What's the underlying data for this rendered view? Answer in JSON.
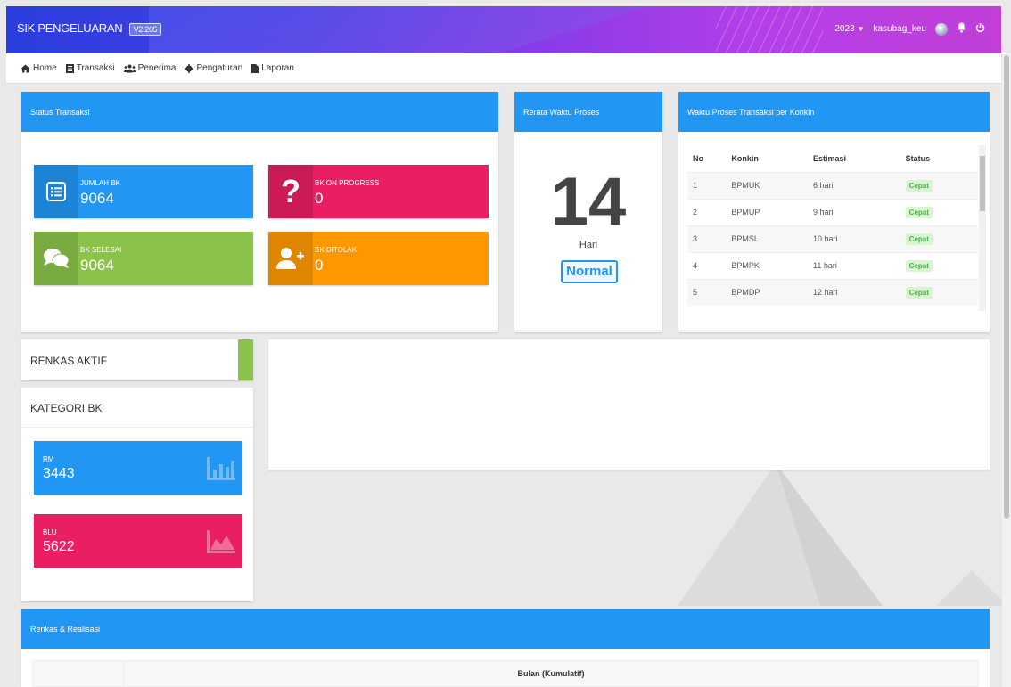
{
  "app": {
    "title": "SIK PENGELUARAN",
    "version": "V2.205"
  },
  "header": {
    "year": "2023",
    "user": "kasubag_keu"
  },
  "nav": [
    {
      "label": "Home",
      "icon": "home-icon"
    },
    {
      "label": "Transaksi",
      "icon": "list-icon"
    },
    {
      "label": "Penerima",
      "icon": "users-icon"
    },
    {
      "label": "Pengaturan",
      "icon": "gear-icon"
    },
    {
      "label": "Laporan",
      "icon": "report-icon"
    }
  ],
  "status_transaksi": {
    "title": "Status Transaksi",
    "tiles": [
      {
        "label": "JUMLAH BK",
        "value": "9064",
        "color": "#2196f3",
        "icon": "list-icon"
      },
      {
        "label": "BK ON PROGRESS",
        "value": "0",
        "color": "#e91e63",
        "icon": "question-icon"
      },
      {
        "label": "BK SELESAI",
        "value": "9064",
        "color": "#8bc34a",
        "icon": "chat-icon"
      },
      {
        "label": "BK DITOLAK",
        "value": "0",
        "color": "#ff9800",
        "icon": "user-plus-icon"
      }
    ]
  },
  "rerata": {
    "title": "Rerata Waktu Proses",
    "value": "14",
    "unit": "Hari",
    "status": "Normal"
  },
  "konkin": {
    "title": "Waktu Proses Transaksi per Konkin",
    "columns": [
      "No",
      "Konkin",
      "Estimasi",
      "Status"
    ],
    "rows": [
      [
        "1",
        "BPMUK",
        "6 hari",
        "Cepat"
      ],
      [
        "2",
        "BPMUP",
        "9 hari",
        "Cepat"
      ],
      [
        "3",
        "BPMSL",
        "10 hari",
        "Cepat"
      ],
      [
        "4",
        "BPMPK",
        "11 hari",
        "Cepat"
      ],
      [
        "5",
        "BPMDP",
        "12 hari",
        "Cepat"
      ]
    ]
  },
  "renkas_aktif": {
    "title": "RENKAS AKTIF"
  },
  "kategori": {
    "title": "KATEGORI BK",
    "tiles": [
      {
        "label": "RM",
        "value": "3443",
        "color": "#2196f3",
        "icon": "bar-chart-icon"
      },
      {
        "label": "BLU",
        "value": "5622",
        "color": "#e91e63",
        "icon": "area-chart-icon"
      }
    ]
  },
  "renkas_realisasi": {
    "title": "Renkas & Realisasi",
    "column_header": "Bulan (Kumulatif)"
  }
}
